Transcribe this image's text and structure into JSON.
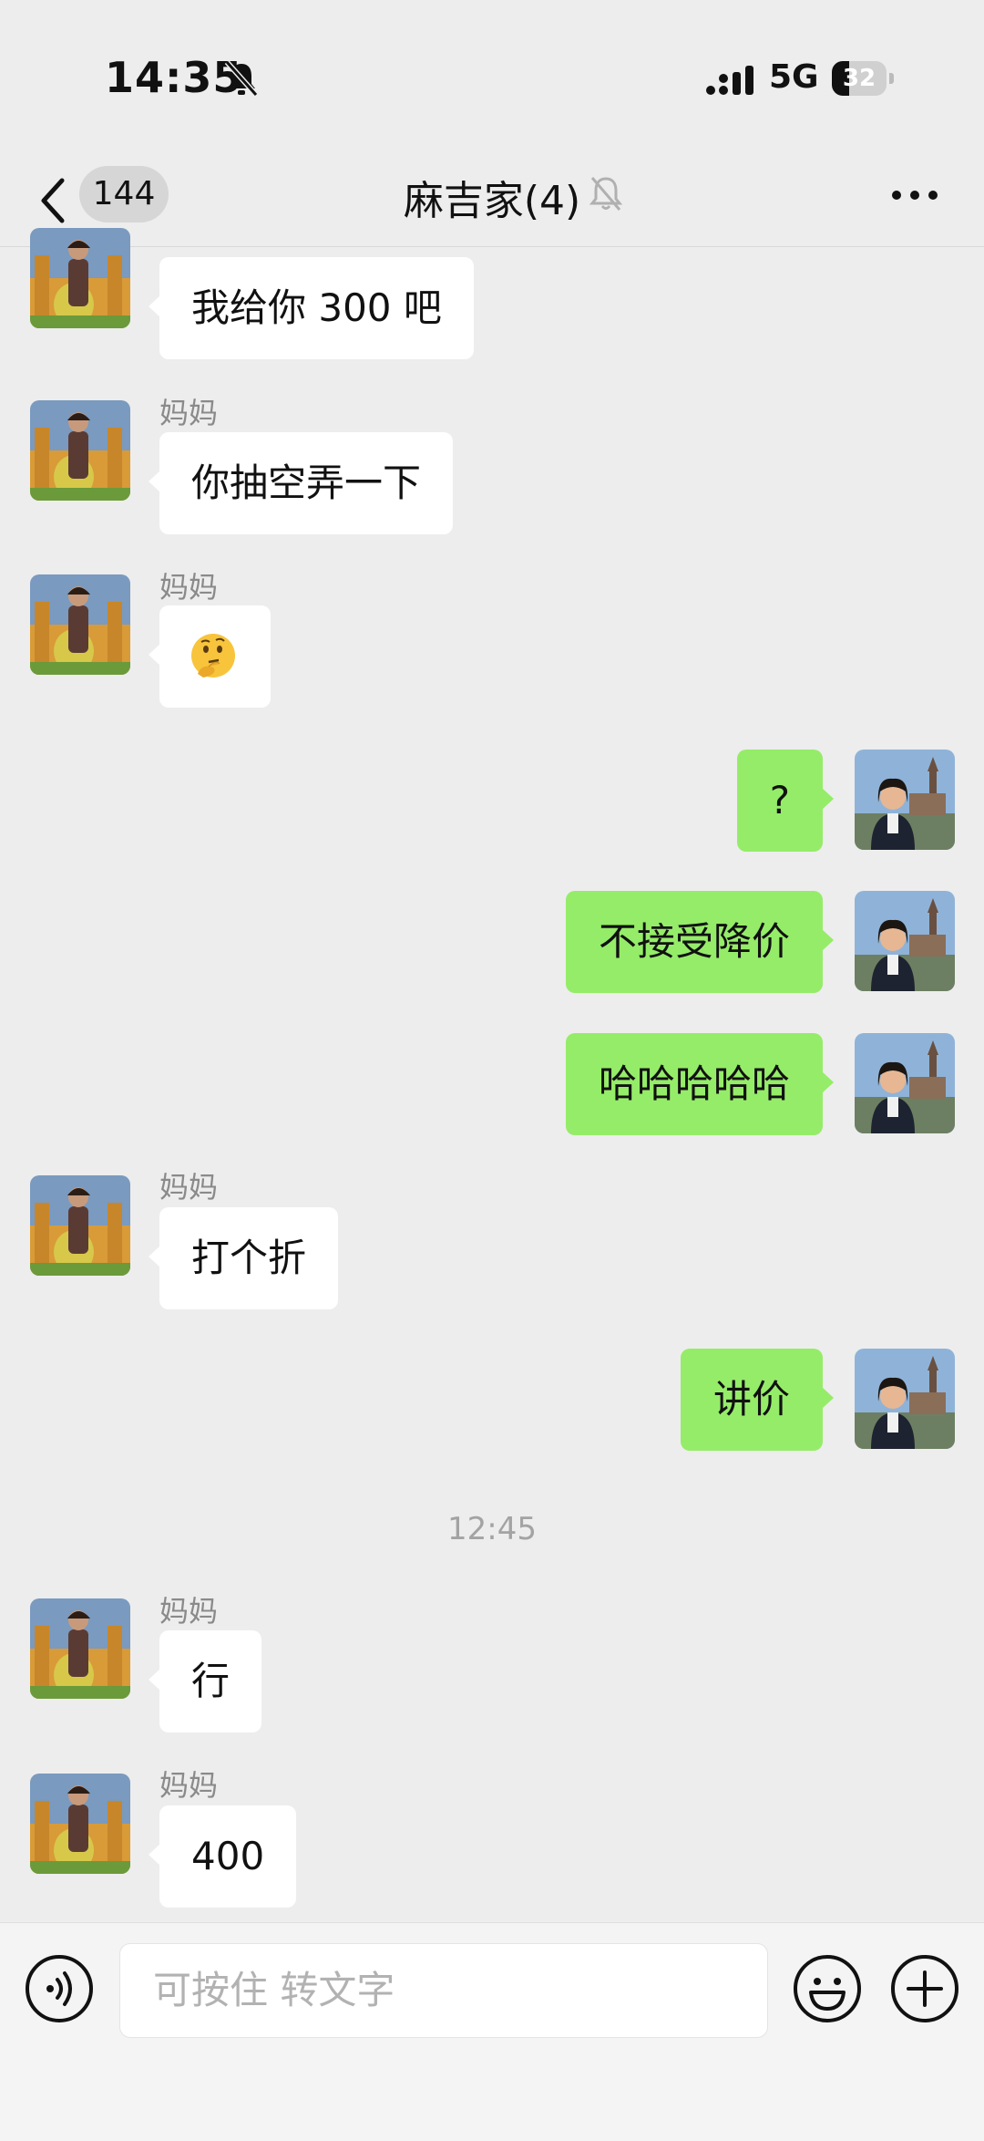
{
  "status_bar": {
    "time": "14:35",
    "network": "5G",
    "battery_percent": 32,
    "battery_label": "32"
  },
  "nav": {
    "unread_count": "144",
    "title": "麻吉家(4)"
  },
  "messages": [
    {
      "side": "in",
      "sender": "",
      "text": "我给你 300 吧"
    },
    {
      "side": "in",
      "sender": "妈妈",
      "text": "你抽空弄一下"
    },
    {
      "side": "in",
      "sender": "妈妈",
      "text": "🤔"
    },
    {
      "side": "out",
      "text": "?"
    },
    {
      "side": "out",
      "text": "不接受降价"
    },
    {
      "side": "out",
      "text": "哈哈哈哈哈"
    },
    {
      "side": "in",
      "sender": "妈妈",
      "text": "打个折"
    },
    {
      "side": "out",
      "text": "讲价"
    },
    {
      "side": "in",
      "sender": "妈妈",
      "text": "行"
    },
    {
      "side": "in",
      "sender": "妈妈",
      "text": "400"
    }
  ],
  "time_separator": "12:45",
  "input_bar": {
    "placeholder": "可按住 转文字"
  },
  "colors": {
    "background": "#ededed",
    "outgoing_bubble": "#95ec69",
    "incoming_bubble": "#ffffff"
  },
  "icons": [
    "back-chevron-icon",
    "bell-muted-icon",
    "more-icon",
    "voice-icon",
    "emoji-icon",
    "plus-icon"
  ]
}
